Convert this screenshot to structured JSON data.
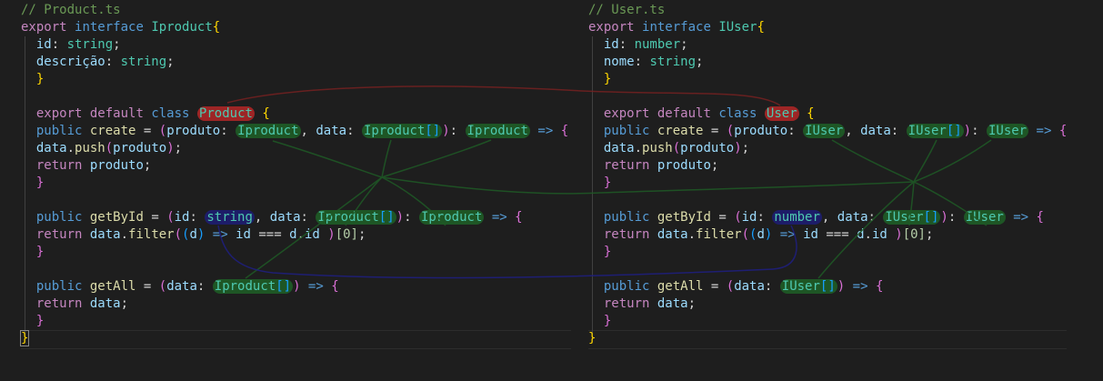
{
  "colors": {
    "background": "#1e1e1e",
    "comment": "#6a9955",
    "keyword": "#c586c0",
    "storage": "#569cd6",
    "type": "#4ec9b0",
    "property": "#9cdcfe",
    "function": "#dcdcaa",
    "brace": "#ffd700",
    "highlight_red": "#c82828",
    "highlight_green": "#1e6e28",
    "highlight_blue": "#1e1e82"
  },
  "left": {
    "comment": "// Product.ts",
    "line_2": {
      "kw_export": "export",
      "kw_interface": "interface",
      "name": "Iproduct",
      "brace": "{"
    },
    "line_3": {
      "prop": "id",
      "colon": ": ",
      "type": "string",
      "semi": ";"
    },
    "line_4": {
      "prop": "descrição",
      "colon": ": ",
      "type": "string",
      "semi": ";"
    },
    "line_5": {
      "brace": "}"
    },
    "line_7": {
      "kw_export": "export",
      "kw_default": "default",
      "kw_class": "class",
      "name": "Product",
      "brace": "{"
    },
    "line_8": {
      "kw_public": "public",
      "method": "create",
      "assign": " = ",
      "p_open": "(",
      "param1": "produto",
      "c1": ": ",
      "type1": "Iproduct",
      "comma": ", ",
      "param2": "data",
      "c2": ": ",
      "type2": "Iproduct",
      "brackets": "[]",
      "p_close": ")",
      "c3": ": ",
      "ret_type": "Iproduct",
      "arrow": " => ",
      "brace": "{"
    },
    "line_9": {
      "obj": "data",
      "dot": ".",
      "method": "push",
      "p_open": "(",
      "arg": "produto",
      "p_close": ")",
      "semi": ";"
    },
    "line_10": {
      "kw_return": "return",
      "value": "produto",
      "semi": ";"
    },
    "line_11": {
      "brace": "}"
    },
    "line_13": {
      "kw_public": "public",
      "method": "getById",
      "assign": " = ",
      "p_open": "(",
      "param1": "id",
      "c1": ": ",
      "type1": "string",
      "comma": ", ",
      "param2": "data",
      "c2": ": ",
      "type2": "Iproduct",
      "brackets": "[]",
      "p_close": ")",
      "c3": ": ",
      "ret_type": "Iproduct",
      "arrow": " => ",
      "brace": "{"
    },
    "line_14": {
      "kw_return": "return",
      "obj": "data",
      "dot": ".",
      "method": "filter",
      "p_open": "(",
      "ip_open": "(",
      "param": "d",
      "ip_close": ")",
      "arrow": " => ",
      "lhs": "id",
      "op": " === ",
      "rhs_obj": "d",
      "rhs_dot": ".",
      "rhs_prop": "id",
      "p_close": " )",
      "index": "[0]",
      "semi": ";"
    },
    "line_15": {
      "brace": "}"
    },
    "line_17": {
      "kw_public": "public",
      "method": "getAll",
      "assign": " = ",
      "p_open": "(",
      "param": "data",
      "c1": ": ",
      "type": "Iproduct",
      "brackets": "[]",
      "p_close": ")",
      "arrow": " => ",
      "brace": "{"
    },
    "line_18": {
      "kw_return": "return",
      "value": "data",
      "semi": ";"
    },
    "line_19": {
      "brace": "}"
    },
    "line_20": {
      "brace": "}"
    }
  },
  "right": {
    "comment": "// User.ts",
    "line_2": {
      "kw_export": "export",
      "kw_interface": "interface",
      "name": "IUser",
      "brace": "{"
    },
    "line_3": {
      "prop": "id",
      "colon": ": ",
      "type": "number",
      "semi": ";"
    },
    "line_4": {
      "prop": "nome",
      "colon": ": ",
      "type": "string",
      "semi": ";"
    },
    "line_5": {
      "brace": "}"
    },
    "line_7": {
      "kw_export": "export",
      "kw_default": "default",
      "kw_class": "class",
      "name": "User",
      "brace": "{"
    },
    "line_8": {
      "kw_public": "public",
      "method": "create",
      "assign": " = ",
      "p_open": "(",
      "param1": "produto",
      "c1": ": ",
      "type1": "IUser",
      "comma": ", ",
      "param2": "data",
      "c2": ": ",
      "type2": "IUser",
      "brackets": "[]",
      "p_close": ")",
      "c3": ": ",
      "ret_type": "IUser",
      "arrow": " => ",
      "brace": "{"
    },
    "line_9": {
      "obj": "data",
      "dot": ".",
      "method": "push",
      "p_open": "(",
      "arg": "produto",
      "p_close": ")",
      "semi": ";"
    },
    "line_10": {
      "kw_return": "return",
      "value": "produto",
      "semi": ";"
    },
    "line_11": {
      "brace": "}"
    },
    "line_13": {
      "kw_public": "public",
      "method": "getById",
      "assign": " = ",
      "p_open": "(",
      "param1": "id",
      "c1": ": ",
      "type1": "number",
      "comma": ", ",
      "param2": "data",
      "c2": ": ",
      "type2": "IUser",
      "brackets": "[]",
      "p_close": ")",
      "c3": ": ",
      "ret_type": "IUser",
      "arrow": " => ",
      "brace": "{"
    },
    "line_14": {
      "kw_return": "return",
      "obj": "data",
      "dot": ".",
      "method": "filter",
      "p_open": "(",
      "ip_open": "(",
      "param": "d",
      "ip_close": ")",
      "arrow": " => ",
      "lhs": "id",
      "op": " === ",
      "rhs_obj": "d",
      "rhs_dot": ".",
      "rhs_prop": "id",
      "p_close": " )",
      "index": "[0]",
      "semi": ";"
    },
    "line_15": {
      "brace": "}"
    },
    "line_17": {
      "kw_public": "public",
      "method": "getAll",
      "assign": " = ",
      "p_open": "(",
      "param": "data",
      "c1": ": ",
      "type": "IUser",
      "brackets": "[]",
      "p_close": ")",
      "arrow": " => ",
      "brace": "{"
    },
    "line_18": {
      "kw_return": "return",
      "value": "data",
      "semi": ";"
    },
    "line_19": {
      "brace": "}"
    },
    "line_20": {
      "brace": "}"
    }
  }
}
